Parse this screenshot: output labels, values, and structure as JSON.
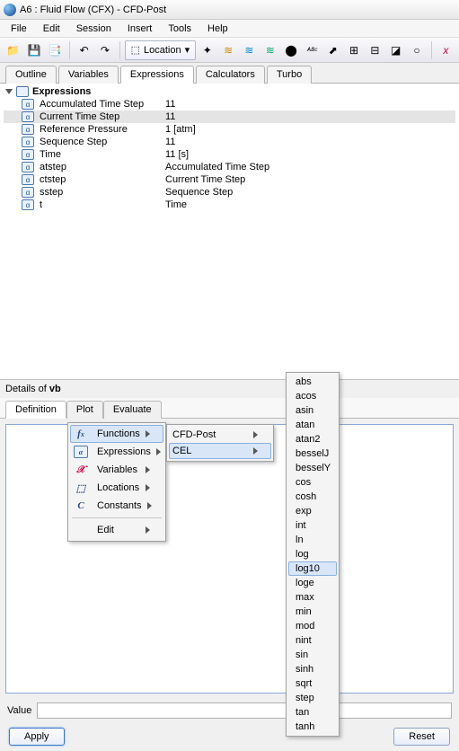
{
  "window": {
    "title": "A6 : Fluid Flow (CFX) - CFD-Post"
  },
  "menus": [
    "File",
    "Edit",
    "Session",
    "Insert",
    "Tools",
    "Help"
  ],
  "toolbar": {
    "location_label": "Location"
  },
  "tabs": {
    "main": [
      "Outline",
      "Variables",
      "Expressions",
      "Calculators",
      "Turbo"
    ],
    "active": "Expressions"
  },
  "tree": {
    "root": "Expressions",
    "rows": [
      {
        "name": "Accumulated Time Step",
        "val": "11",
        "sel": false
      },
      {
        "name": "Current Time Step",
        "val": "11",
        "sel": true
      },
      {
        "name": "Reference Pressure",
        "val": "1 [atm]",
        "sel": false
      },
      {
        "name": "Sequence Step",
        "val": "11",
        "sel": false
      },
      {
        "name": "Time",
        "val": "11 [s]",
        "sel": false
      },
      {
        "name": "atstep",
        "val": "Accumulated Time Step",
        "sel": false
      },
      {
        "name": "ctstep",
        "val": "Current Time Step",
        "sel": false
      },
      {
        "name": "sstep",
        "val": "Sequence Step",
        "sel": false
      },
      {
        "name": "t",
        "val": "Time",
        "sel": false
      }
    ]
  },
  "details": {
    "header_prefix": "Details of ",
    "header_name": "vb",
    "tabs": [
      "Definition",
      "Plot",
      "Evaluate"
    ],
    "active": "Definition",
    "value_label": "Value",
    "apply": "Apply",
    "reset": "Reset"
  },
  "context": {
    "main": [
      {
        "icon": "fx",
        "label": "Functions",
        "sub": true
      },
      {
        "icon": "ex",
        "label": "Expressions",
        "sub": true
      },
      {
        "icon": "x",
        "label": "Variables",
        "sub": true
      },
      {
        "icon": "loc",
        "label": "Locations",
        "sub": true
      },
      {
        "icon": "c",
        "label": "Constants",
        "sub": true
      },
      {
        "sep": true
      },
      {
        "icon": "",
        "label": "Edit",
        "sub": true
      }
    ],
    "sub": [
      {
        "label": "CFD-Post",
        "sub": true
      },
      {
        "label": "CEL",
        "sub": true
      }
    ],
    "funcs": [
      "abs",
      "acos",
      "asin",
      "atan",
      "atan2",
      "besselJ",
      "besselY",
      "cos",
      "cosh",
      "exp",
      "int",
      "ln",
      "log",
      "log10",
      "loge",
      "max",
      "min",
      "mod",
      "nint",
      "sin",
      "sinh",
      "sqrt",
      "step",
      "tan",
      "tanh"
    ],
    "func_hover": "log10"
  }
}
